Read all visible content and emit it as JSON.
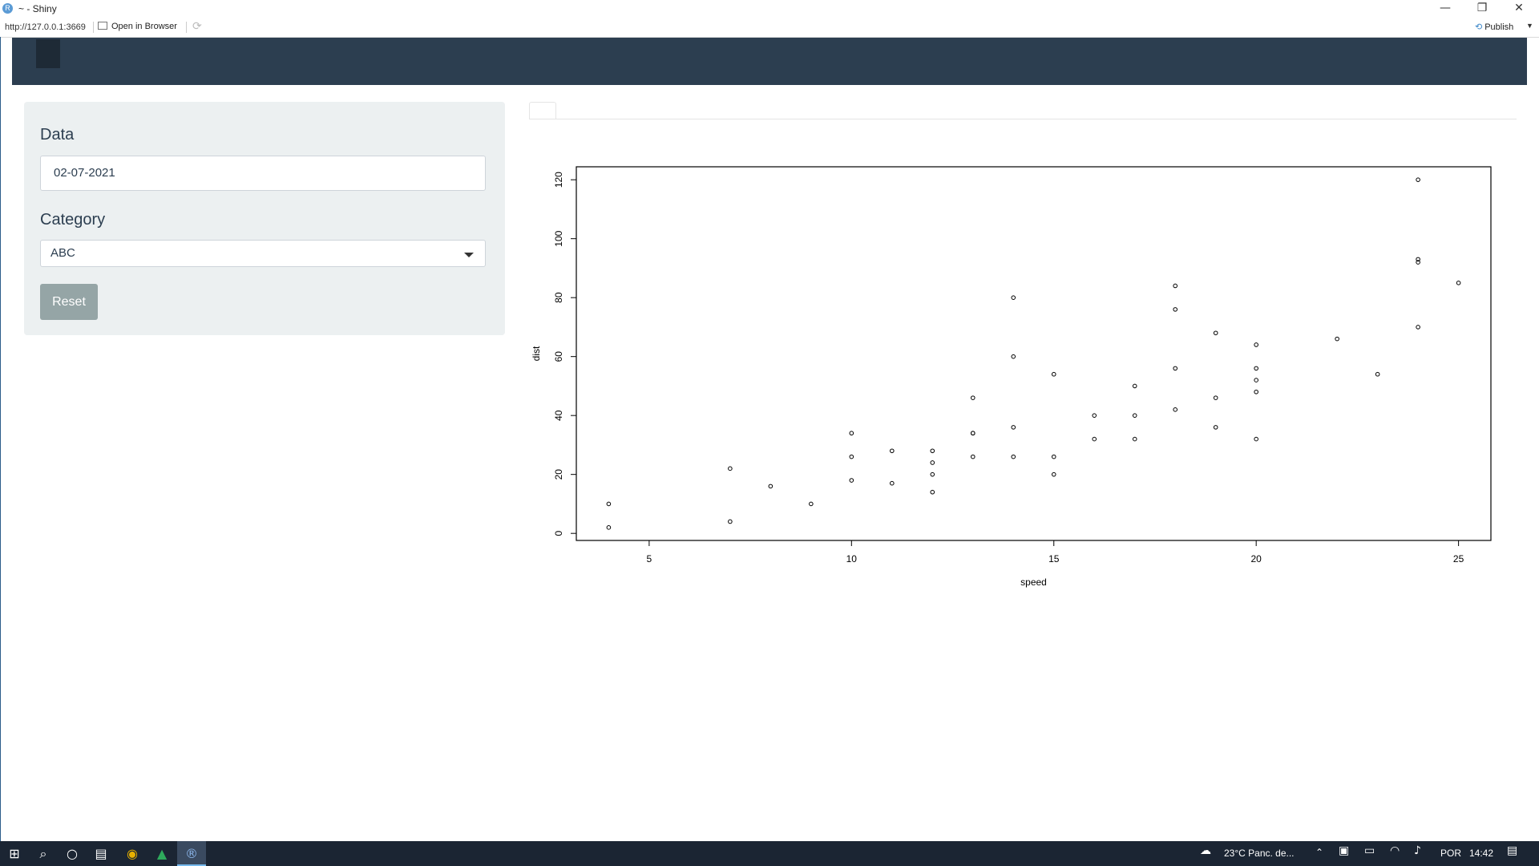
{
  "window": {
    "title": "~ - Shiny",
    "app_icon": "R",
    "buttons": {
      "minimize": "—",
      "restore": "❐",
      "close": "✕"
    }
  },
  "viewer_toolbar": {
    "url": "http://127.0.0.1:3669",
    "open_in_browser": "Open in Browser",
    "refresh_icon": "refresh-icon",
    "publish": "Publish"
  },
  "sidebar": {
    "date_label": "Data",
    "date_value": "02-07-2021",
    "category_label": "Category",
    "category_value": "ABC",
    "reset_label": "Reset"
  },
  "chart_data": {
    "type": "scatter",
    "xlabel": "speed",
    "ylabel": "dist",
    "xlim": [
      3.2,
      25.8
    ],
    "ylim": [
      -2.4,
      124.4
    ],
    "xticks": [
      5,
      10,
      15,
      20,
      25
    ],
    "yticks": [
      0,
      20,
      40,
      60,
      80,
      100,
      120
    ],
    "points": [
      {
        "x": 4,
        "y": 2
      },
      {
        "x": 4,
        "y": 10
      },
      {
        "x": 7,
        "y": 4
      },
      {
        "x": 7,
        "y": 22
      },
      {
        "x": 8,
        "y": 16
      },
      {
        "x": 9,
        "y": 10
      },
      {
        "x": 10,
        "y": 18
      },
      {
        "x": 10,
        "y": 26
      },
      {
        "x": 10,
        "y": 34
      },
      {
        "x": 11,
        "y": 17
      },
      {
        "x": 11,
        "y": 28
      },
      {
        "x": 12,
        "y": 14
      },
      {
        "x": 12,
        "y": 20
      },
      {
        "x": 12,
        "y": 24
      },
      {
        "x": 12,
        "y": 28
      },
      {
        "x": 13,
        "y": 26
      },
      {
        "x": 13,
        "y": 34
      },
      {
        "x": 13,
        "y": 34
      },
      {
        "x": 13,
        "y": 46
      },
      {
        "x": 14,
        "y": 26
      },
      {
        "x": 14,
        "y": 36
      },
      {
        "x": 14,
        "y": 60
      },
      {
        "x": 14,
        "y": 80
      },
      {
        "x": 15,
        "y": 20
      },
      {
        "x": 15,
        "y": 26
      },
      {
        "x": 15,
        "y": 54
      },
      {
        "x": 16,
        "y": 32
      },
      {
        "x": 16,
        "y": 40
      },
      {
        "x": 17,
        "y": 32
      },
      {
        "x": 17,
        "y": 40
      },
      {
        "x": 17,
        "y": 50
      },
      {
        "x": 18,
        "y": 42
      },
      {
        "x": 18,
        "y": 56
      },
      {
        "x": 18,
        "y": 76
      },
      {
        "x": 18,
        "y": 84
      },
      {
        "x": 19,
        "y": 36
      },
      {
        "x": 19,
        "y": 46
      },
      {
        "x": 19,
        "y": 68
      },
      {
        "x": 20,
        "y": 32
      },
      {
        "x": 20,
        "y": 48
      },
      {
        "x": 20,
        "y": 52
      },
      {
        "x": 20,
        "y": 56
      },
      {
        "x": 20,
        "y": 64
      },
      {
        "x": 22,
        "y": 66
      },
      {
        "x": 23,
        "y": 54
      },
      {
        "x": 24,
        "y": 70
      },
      {
        "x": 24,
        "y": 92
      },
      {
        "x": 24,
        "y": 93
      },
      {
        "x": 24,
        "y": 120
      },
      {
        "x": 25,
        "y": 85
      }
    ]
  },
  "taskbar": {
    "icons": [
      "windows-start-icon",
      "search-icon",
      "cortana-icon",
      "task-view-icon",
      "chrome-icon",
      "google-drive-icon",
      "rstudio-icon"
    ],
    "weather": "23°C  Panc. de...",
    "language": "POR",
    "time": "14:42"
  }
}
